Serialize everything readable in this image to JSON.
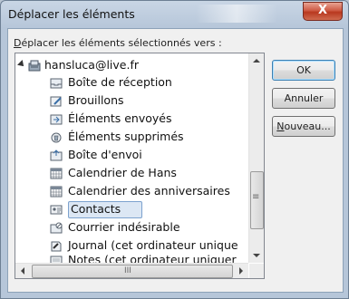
{
  "dialog": {
    "title": "Déplacer les éléments",
    "close_symbol": "X"
  },
  "prompt": {
    "mnemonic": "D",
    "rest": "éplacer les éléments sélectionnés vers :"
  },
  "tree": {
    "root": {
      "label": "hansluca@live.fr",
      "icon": "account-icon",
      "expanded": true
    },
    "items": [
      {
        "label": "Boîte de réception",
        "icon": "inbox-icon"
      },
      {
        "label": "Brouillons",
        "icon": "drafts-icon"
      },
      {
        "label": "Éléments envoyés",
        "icon": "sent-icon"
      },
      {
        "label": "Éléments supprimés",
        "icon": "deleted-icon"
      },
      {
        "label": "Boîte d'envoi",
        "icon": "outbox-icon"
      },
      {
        "label": "Calendrier de Hans",
        "icon": "calendar-icon"
      },
      {
        "label": "Calendrier des anniversaires",
        "icon": "calendar-icon"
      },
      {
        "label": "Contacts",
        "icon": "contacts-icon",
        "selected": true
      },
      {
        "label": "Courrier indésirable",
        "icon": "junk-icon"
      },
      {
        "label": "Journal (cet ordinateur unique",
        "icon": "journal-icon"
      },
      {
        "label": "Notes (cet ordinateur uniquer",
        "icon": "notes-icon"
      }
    ]
  },
  "buttons": {
    "ok": "OK",
    "cancel": "Annuler",
    "new_mnemonic": "N",
    "new_rest": "ouveau..."
  },
  "scrollbar": {
    "vertical_grip": "≡",
    "horizontal_grip": "III"
  }
}
